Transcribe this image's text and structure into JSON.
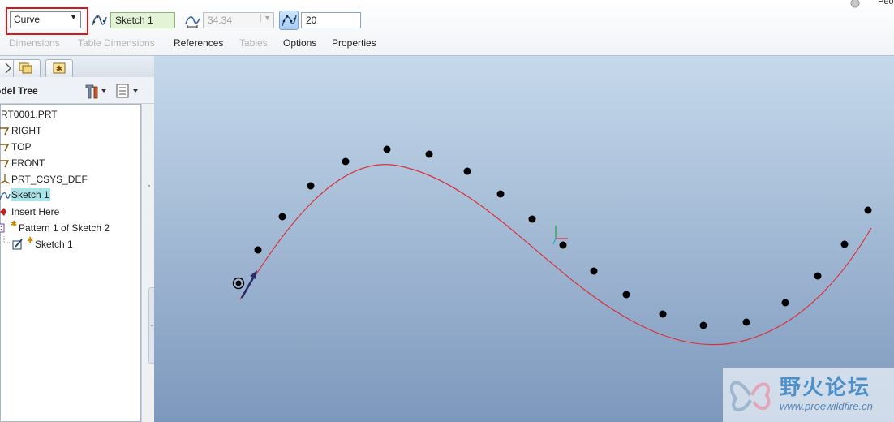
{
  "dashboard": {
    "type_select": {
      "value": "Curve"
    },
    "reference_field": {
      "value": "Sketch 1"
    },
    "spacing_field": {
      "value": "34.34"
    },
    "number_field": {
      "value": "20"
    },
    "tabs": [
      {
        "label": "Dimensions",
        "enabled": false
      },
      {
        "label": "Table Dimensions",
        "enabled": false
      },
      {
        "label": "References",
        "enabled": true
      },
      {
        "label": "Tables",
        "enabled": false
      },
      {
        "label": "Options",
        "enabled": true
      },
      {
        "label": "Properties",
        "enabled": true
      }
    ],
    "top_right_label": "Peo"
  },
  "model_tree": {
    "title": "odel Tree",
    "items": [
      {
        "label": "RT0001.PRT",
        "icon": "part-icon"
      },
      {
        "label": "RIGHT",
        "icon": "datum-plane-icon"
      },
      {
        "label": "TOP",
        "icon": "datum-plane-icon"
      },
      {
        "label": "FRONT",
        "icon": "datum-plane-icon"
      },
      {
        "label": "PRT_CSYS_DEF",
        "icon": "csys-icon"
      },
      {
        "label": "Sketch 1",
        "icon": "sketch-curve-icon",
        "selected": true
      },
      {
        "label": "Insert Here",
        "icon": "insert-here-icon"
      },
      {
        "label": "Pattern 1 of Sketch 2",
        "icon": "pattern-icon"
      },
      {
        "label": "Sketch 1",
        "icon": "sketch-icon"
      }
    ]
  },
  "colors": {
    "curve": "#d8333d",
    "highlight_box": "#d21a1a",
    "selected_bg": "#a9e4ea",
    "reference_bg": "#e3f3d6"
  },
  "watermark": {
    "title": "野火论坛",
    "url": "www.proewildfire.cn"
  }
}
